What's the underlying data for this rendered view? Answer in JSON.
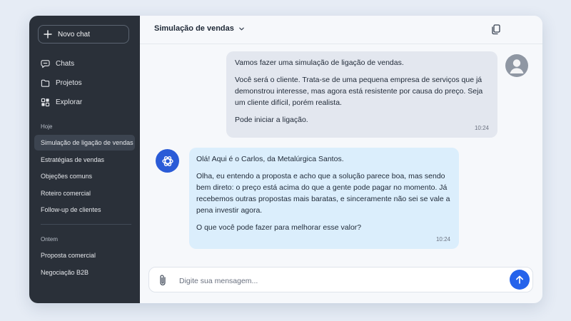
{
  "sidebar": {
    "new_chat_label": "Novo chat",
    "nav": [
      {
        "label": "Chats",
        "icon": "chat-bubble-icon"
      },
      {
        "label": "Projetos",
        "icon": "folder-icon"
      },
      {
        "label": "Explorar",
        "icon": "grid-icon"
      }
    ],
    "sections": [
      {
        "label": "Hoje",
        "items": [
          "Simulação de ligação de vendas",
          "Estratégias de vendas",
          "Objeções comuns",
          "Roteiro comercial",
          "Follow-up de clientes"
        ]
      },
      {
        "label": "Ontem",
        "items": [
          "Proposta comercial",
          "Negociação B2B"
        ]
      }
    ],
    "active_item": "Simulação de ligação de vendas"
  },
  "header": {
    "title": "Simulação de vendas",
    "icons": [
      "chevron-down-icon",
      "copy-icon",
      "more-options-icon"
    ]
  },
  "messages": [
    {
      "role": "user",
      "paragraphs": [
        "Vamos fazer uma simulação de ligação de vendas.",
        "Você será o cliente. Trata-se de uma pequena empresa de serviços que já demonstrou interesse, mas agora está resistente por causa do preço. Seja um cliente difícil, porém realista.",
        "Pode iniciar a ligação."
      ],
      "time": "10:24"
    },
    {
      "role": "assistant",
      "paragraphs": [
        "Olá! Aqui é o Carlos, da Metalúrgica Santos.",
        "Olha, eu entendo a proposta e acho que a solução parece boa, mas sendo bem direto: o preço está acima do que a gente pode pagar no momento. Já recebemos outras propostas mais baratas, e sinceramente não sei se vale a pena investir agora.",
        "O que você pode fazer para melhorar esse valor?"
      ],
      "time": "10:24"
    }
  ],
  "composer": {
    "placeholder": "Digite sua mensagem...",
    "value": ""
  },
  "colors": {
    "accent": "#2563eb",
    "sidebar_bg": "#2a3039",
    "user_bubble": "#e3e7ef",
    "assistant_bubble": "#dbeefc"
  }
}
